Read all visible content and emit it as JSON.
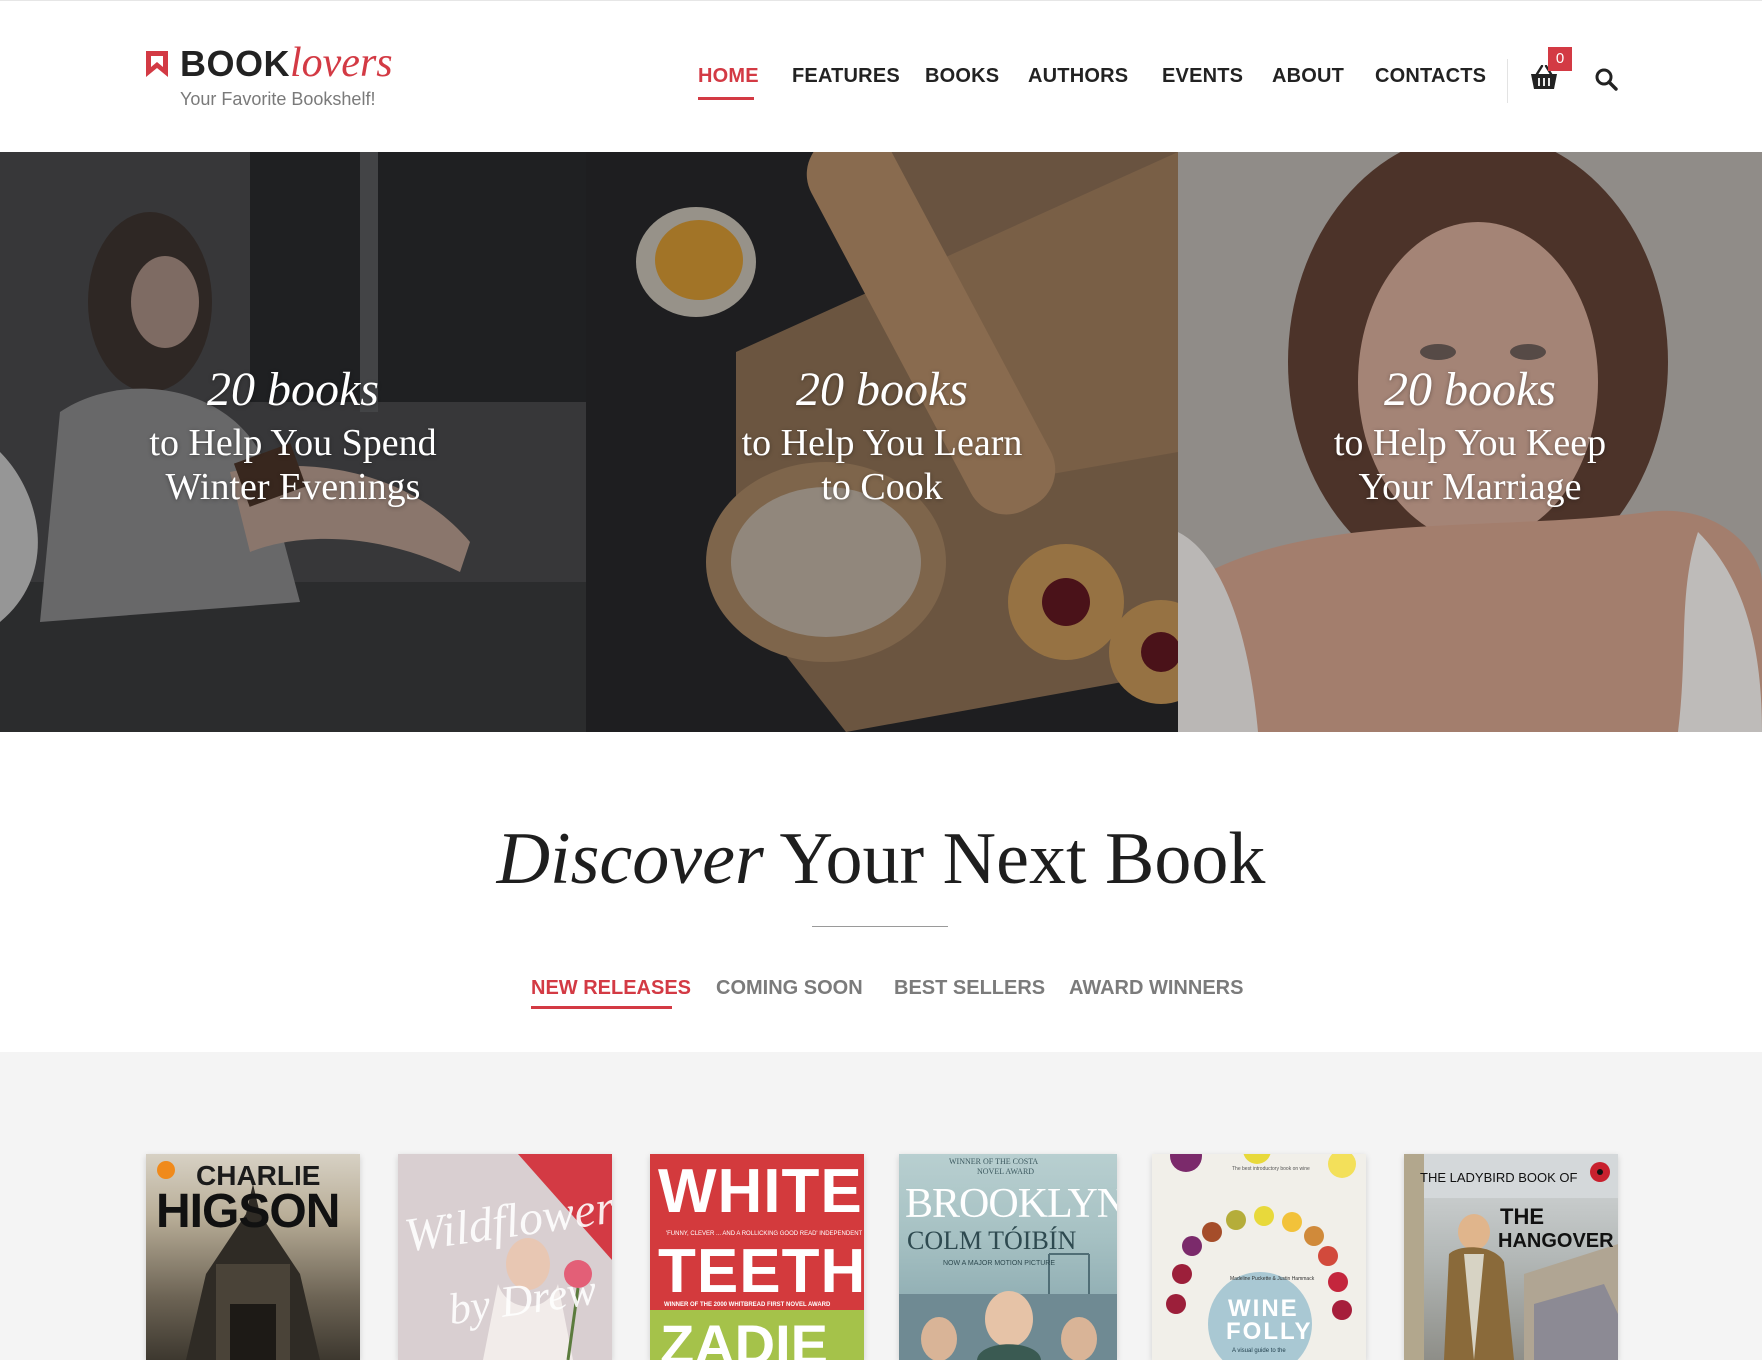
{
  "brand": {
    "name_bold": "BOOK",
    "name_script": "lovers",
    "tagline": "Your Favorite Bookshelf!",
    "accent_color": "#d33a44"
  },
  "nav": {
    "items": [
      {
        "label": "HOME",
        "active": true
      },
      {
        "label": "FEATURES",
        "active": false
      },
      {
        "label": "BOOKS",
        "active": false
      },
      {
        "label": "AUTHORS",
        "active": false
      },
      {
        "label": "EVENTS",
        "active": false
      },
      {
        "label": "ABOUT",
        "active": false
      },
      {
        "label": "CONTACTS",
        "active": false
      }
    ],
    "cart_count": "0",
    "cart_icon": "cart-icon",
    "search_icon": "search-icon"
  },
  "hero": {
    "panels": [
      {
        "kicker": "20 books",
        "line1": "to Help You Spend",
        "line2": "Winter Evenings"
      },
      {
        "kicker": "20 books",
        "line1": "to Help You Learn",
        "line2": "to Cook"
      },
      {
        "kicker": "20 books",
        "line1": "to Help You Keep",
        "line2": "Your Marriage"
      }
    ]
  },
  "discover": {
    "title_em": "Discover",
    "title_rest": " Your Next Book",
    "tabs": [
      {
        "label": "NEW RELEASES",
        "active": true
      },
      {
        "label": "COMING SOON",
        "active": false
      },
      {
        "label": "BEST SELLERS",
        "active": false
      },
      {
        "label": "AWARD WINNERS",
        "active": false
      }
    ]
  },
  "books": [
    {
      "line1": "CHARLIE",
      "line2": "HIGSON"
    },
    {
      "line1": "Wildflower",
      "line2": "by Drew"
    },
    {
      "line1": "WHITE",
      "line2": "TEETH",
      "line3": "'FUNNY, CLEVER ... AND A ROLLICKING GOOD READ' INDEPENDENT",
      "line4": "WINNER OF THE 2000 WHITBREAD FIRST NOVEL AWARD",
      "line5": "ZADIE"
    },
    {
      "line1": "WINNER OF THE COSTA",
      "line2": "NOVEL AWARD",
      "line3": "BROOKLYN",
      "line4": "COLM TÓIBÍN",
      "line5": "NOW A MAJOR MOTION PICTURE"
    },
    {
      "line1": "The best introductory book on wine",
      "line2": "Madeline Puckette & Justin Hammack",
      "line3": "WINE",
      "line4": "FOLLY",
      "line5": "A visual guide to the"
    },
    {
      "line1": "THE LADYBIRD BOOK OF",
      "line2": "THE",
      "line3": "HANGOVER"
    }
  ]
}
